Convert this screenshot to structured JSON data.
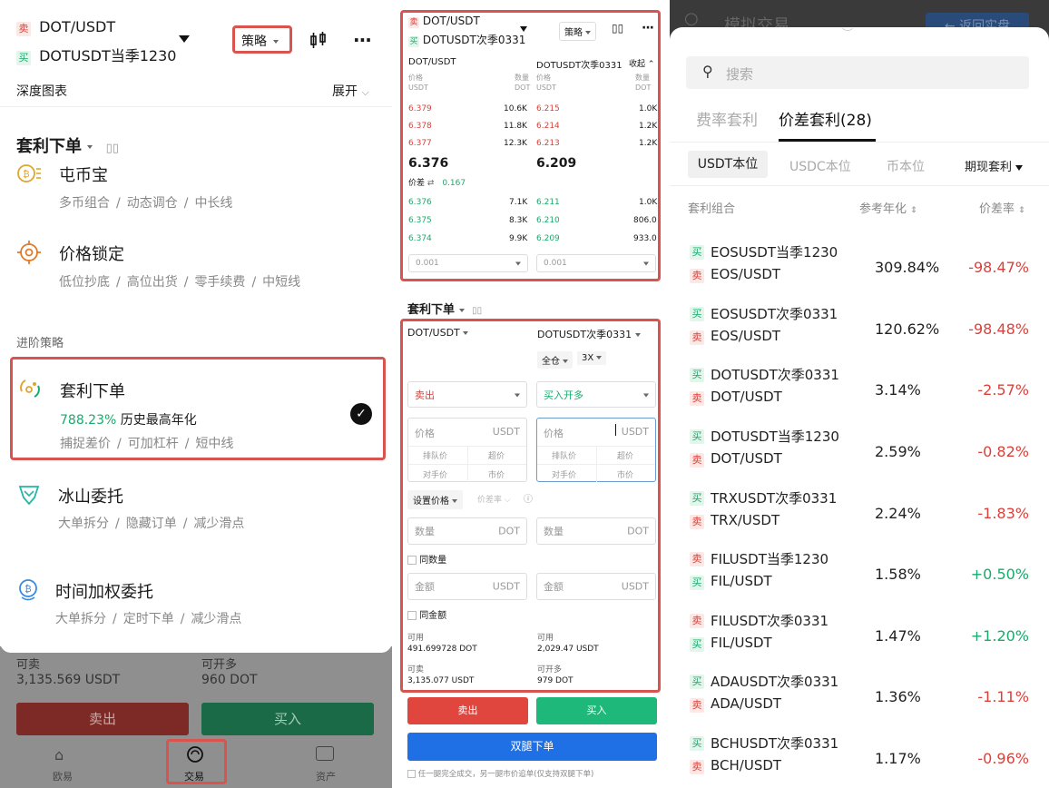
{
  "panel1": {
    "pair_sell_tag": "卖",
    "pair_sell": "DOT/USDT",
    "pair_buy_tag": "买",
    "pair_buy": "DOTUSDT当季1230",
    "strategy_btn": "策略",
    "depth_label": "深度图表",
    "expand_label": "展开",
    "arb_title": "套利下单",
    "items": [
      {
        "title": "屯币宝",
        "subs": [
          "多币组合",
          "动态调仓",
          "中长线"
        ]
      },
      {
        "title": "价格锁定",
        "subs": [
          "低位抄底",
          "高位出货",
          "零手续费",
          "中短线"
        ]
      }
    ],
    "advanced_label": "进阶策略",
    "selected": {
      "title": "套利下单",
      "rate": "788.23%",
      "rate_desc": "历史最高年化",
      "subs": [
        "捕捉差价",
        "可加杠杆",
        "短中线"
      ]
    },
    "items2": [
      {
        "title": "冰山委托",
        "subs": [
          "大单拆分",
          "隐藏订单",
          "减少滑点"
        ]
      },
      {
        "title": "时间加权委托",
        "subs": [
          "大单拆分",
          "定时下单",
          "减少滑点"
        ]
      }
    ],
    "bottom": {
      "can_sell_label": "可卖",
      "can_sell_val": "3,135.569 USDT",
      "can_buy_label": "可开多",
      "can_buy_val": "960 DOT",
      "sell_btn": "卖出",
      "buy_btn": "买入",
      "nav": [
        "欧易",
        "交易",
        "资产"
      ]
    }
  },
  "panel2": {
    "pair_sell_tag": "卖",
    "pair_sell": "DOT/USDT",
    "pair_buy_tag": "买",
    "pair_buy": "DOTUSDT次季0331",
    "strategy_btn": "策略",
    "left_book": {
      "name": "DOT/USDT",
      "col_price": "价格",
      "col_price_unit": "USDT",
      "col_qty": "数量",
      "col_qty_unit": "DOT",
      "asks": [
        [
          "6.379",
          "10.6K"
        ],
        [
          "6.378",
          "11.8K"
        ],
        [
          "6.377",
          "12.3K"
        ]
      ],
      "last": "6.376",
      "bids": [
        [
          "6.376",
          "7.1K"
        ],
        [
          "6.375",
          "8.3K"
        ],
        [
          "6.374",
          "9.9K"
        ]
      ],
      "step": "0.001"
    },
    "right_book": {
      "name": "DOTUSDT次季0331",
      "collapse": "收起",
      "col_price": "价格",
      "col_price_unit": "USDT",
      "col_qty": "数量",
      "col_qty_unit": "DOT",
      "asks": [
        [
          "6.215",
          "1.0K"
        ],
        [
          "6.214",
          "1.2K"
        ],
        [
          "6.213",
          "1.2K"
        ]
      ],
      "last": "6.209",
      "bids": [
        [
          "6.211",
          "1.0K"
        ],
        [
          "6.210",
          "806.0"
        ],
        [
          "6.209",
          "933.0"
        ]
      ],
      "step": "0.001"
    },
    "spread_label": "价差",
    "spread_val": "0.167",
    "arb_title": "套利下单",
    "form": {
      "left_pair": "DOT/USDT",
      "right_pair": "DOTUSDT次季0331",
      "margin": "全仓",
      "leverage": "3X",
      "left_side": "卖出",
      "right_side": "买入开多",
      "price_ph": "价格",
      "price_unit": "USDT",
      "quick": [
        "排队价",
        "超价",
        "对手价",
        "市价"
      ],
      "set_price": "设置价格",
      "spread_rate": "价差率",
      "qty_ph": "数量",
      "qty_unit": "DOT",
      "same_qty": "同数量",
      "amt_ph": "金额",
      "amt_unit": "USDT",
      "same_amt": "同金额",
      "left_avail_label": "可用",
      "left_avail": "491.699728 DOT",
      "left_can_label": "可卖",
      "left_can": "3,135.077 USDT",
      "right_avail_label": "可用",
      "right_avail": "2,029.47 USDT",
      "right_can_label": "可开多",
      "right_can": "979 DOT"
    },
    "sell_btn": "卖出",
    "buy_btn": "买入",
    "dual_btn": "双腿下单",
    "note": "任一腿完全成交，另一腿市价追单(仅支持双腿下单)"
  },
  "panel3": {
    "header_title": "模拟交易",
    "header_btn": "返回实盘",
    "search_ph": "搜索",
    "tabs": [
      "费率套利",
      "价差套利(28)"
    ],
    "filters": [
      "USDT本位",
      "USDC本位",
      "币本位",
      "期现套利"
    ],
    "cols": [
      "套利组合",
      "参考年化",
      "价差率"
    ],
    "rows": [
      {
        "t1": "买",
        "n1": "EOSUSDT当季1230",
        "t2": "卖",
        "n2": "EOS/USDT",
        "yr": "309.84%",
        "rate": "-98.47%",
        "pos": false
      },
      {
        "t1": "买",
        "n1": "EOSUSDT次季0331",
        "t2": "卖",
        "n2": "EOS/USDT",
        "yr": "120.62%",
        "rate": "-98.48%",
        "pos": false
      },
      {
        "t1": "买",
        "n1": "DOTUSDT次季0331",
        "t2": "卖",
        "n2": "DOT/USDT",
        "yr": "3.14%",
        "rate": "-2.57%",
        "pos": false
      },
      {
        "t1": "买",
        "n1": "DOTUSDT当季1230",
        "t2": "卖",
        "n2": "DOT/USDT",
        "yr": "2.59%",
        "rate": "-0.82%",
        "pos": false
      },
      {
        "t1": "买",
        "n1": "TRXUSDT次季0331",
        "t2": "卖",
        "n2": "TRX/USDT",
        "yr": "2.24%",
        "rate": "-1.83%",
        "pos": false
      },
      {
        "t1": "卖",
        "n1": "FILUSDT当季1230",
        "t2": "买",
        "n2": "FIL/USDT",
        "yr": "1.58%",
        "rate": "+0.50%",
        "pos": true
      },
      {
        "t1": "卖",
        "n1": "FILUSDT次季0331",
        "t2": "买",
        "n2": "FIL/USDT",
        "yr": "1.47%",
        "rate": "+1.20%",
        "pos": true
      },
      {
        "t1": "买",
        "n1": "ADAUSDT次季0331",
        "t2": "卖",
        "n2": "ADA/USDT",
        "yr": "1.36%",
        "rate": "-1.11%",
        "pos": false
      },
      {
        "t1": "买",
        "n1": "BCHUSDT次季0331",
        "t2": "卖",
        "n2": "BCH/USDT",
        "yr": "1.17%",
        "rate": "-0.96%",
        "pos": false
      }
    ]
  },
  "colors": {
    "sell": "#d9423b",
    "buy": "#1aaa6c",
    "accent": "#1f6fe5",
    "highlight": "#d9534f"
  }
}
